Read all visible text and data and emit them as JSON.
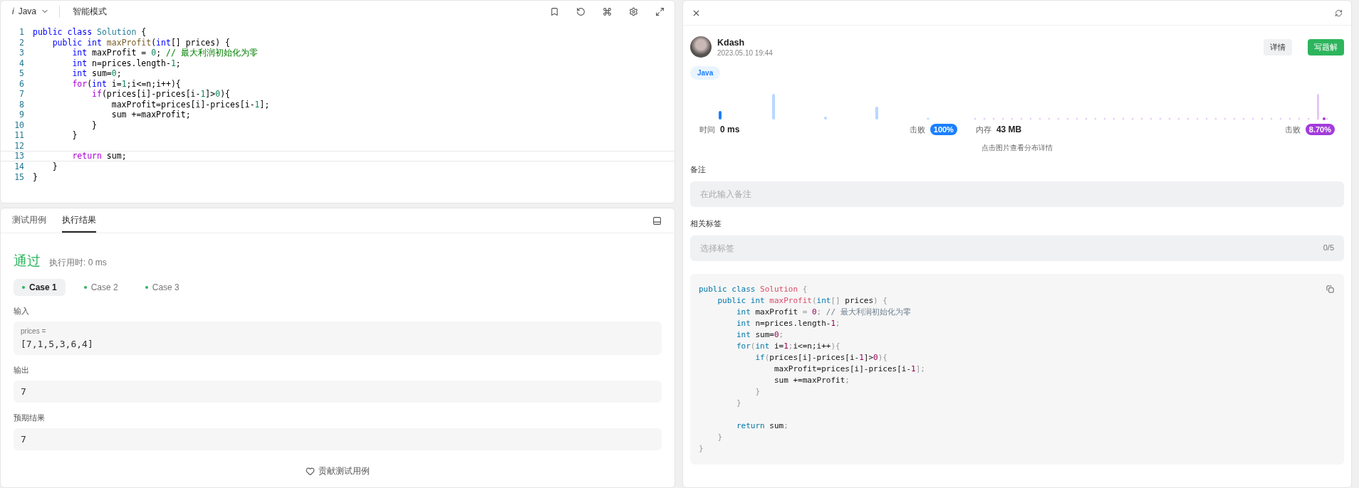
{
  "editor": {
    "language_icon": "i",
    "language": "Java",
    "mode": "智能模式",
    "lines": [
      {
        "number": "1",
        "tokens": [
          {
            "kind": "kw",
            "text": "public class "
          },
          {
            "kind": "type",
            "text": "Solution"
          },
          {
            "kind": "plain",
            "text": " {"
          }
        ]
      },
      {
        "number": "2",
        "tokens": [
          {
            "kind": "kw",
            "text": "    public int "
          },
          {
            "kind": "fn",
            "text": "maxProfit"
          },
          {
            "kind": "plain",
            "text": "("
          },
          {
            "kind": "kw",
            "text": "int"
          },
          {
            "kind": "plain",
            "text": "[] prices) {"
          }
        ]
      },
      {
        "number": "3",
        "tokens": [
          {
            "kind": "kw",
            "text": "        int"
          },
          {
            "kind": "plain",
            "text": " maxProfit = "
          },
          {
            "kind": "num",
            "text": "0"
          },
          {
            "kind": "plain",
            "text": "; "
          },
          {
            "kind": "cm",
            "text": "// 最大利润初始化为零"
          }
        ]
      },
      {
        "number": "4",
        "tokens": [
          {
            "kind": "kw",
            "text": "        int"
          },
          {
            "kind": "plain",
            "text": " n=prices.length-"
          },
          {
            "kind": "num",
            "text": "1"
          },
          {
            "kind": "plain",
            "text": ";"
          }
        ]
      },
      {
        "number": "5",
        "tokens": [
          {
            "kind": "kw",
            "text": "        int"
          },
          {
            "kind": "plain",
            "text": " sum="
          },
          {
            "kind": "num",
            "text": "0"
          },
          {
            "kind": "plain",
            "text": ";"
          }
        ]
      },
      {
        "number": "6",
        "tokens": [
          {
            "kind": "ctl",
            "text": "        for"
          },
          {
            "kind": "plain",
            "text": "("
          },
          {
            "kind": "kw",
            "text": "int"
          },
          {
            "kind": "plain",
            "text": " i="
          },
          {
            "kind": "num",
            "text": "1"
          },
          {
            "kind": "plain",
            "text": ";i<=n;i++){"
          }
        ]
      },
      {
        "number": "7",
        "tokens": [
          {
            "kind": "ctl",
            "text": "            if"
          },
          {
            "kind": "plain",
            "text": "(prices[i]-prices[i-"
          },
          {
            "kind": "num",
            "text": "1"
          },
          {
            "kind": "plain",
            "text": "]>"
          },
          {
            "kind": "num",
            "text": "0"
          },
          {
            "kind": "plain",
            "text": "){"
          }
        ]
      },
      {
        "number": "8",
        "tokens": [
          {
            "kind": "plain",
            "text": "                maxProfit=prices[i]-prices[i-"
          },
          {
            "kind": "num",
            "text": "1"
          },
          {
            "kind": "plain",
            "text": "];"
          }
        ]
      },
      {
        "number": "9",
        "tokens": [
          {
            "kind": "plain",
            "text": "                sum +=maxProfit;"
          }
        ]
      },
      {
        "number": "10",
        "tokens": [
          {
            "kind": "plain",
            "text": "            }"
          }
        ]
      },
      {
        "number": "11",
        "tokens": [
          {
            "kind": "plain",
            "text": "        }"
          }
        ]
      },
      {
        "number": "12"
      },
      {
        "number": "13",
        "tokens": [
          {
            "kind": "ctl",
            "text": "        return"
          },
          {
            "kind": "plain",
            "text": " sum;"
          }
        ]
      },
      {
        "number": "14",
        "tokens": [
          {
            "kind": "plain",
            "text": "    }"
          }
        ]
      },
      {
        "number": "15",
        "tokens": [
          {
            "kind": "plain",
            "text": "}"
          }
        ]
      }
    ]
  },
  "console": {
    "tabs": [
      {
        "label": "测试用例",
        "selected": false
      },
      {
        "label": "执行结果",
        "selected": true
      }
    ],
    "status": "通过",
    "runtime": "执行用时: 0 ms",
    "cases": [
      {
        "label": "Case 1",
        "selected": true
      },
      {
        "label": "Case 2",
        "selected": false
      },
      {
        "label": "Case 3",
        "selected": false
      }
    ],
    "input_label": "输入",
    "input_name": "prices =",
    "input_value": "[7,1,5,3,6,4]",
    "output_label": "输出",
    "output_value": "7",
    "expected_label": "预期结果",
    "expected_value": "7",
    "contribute": "贡献测试用例"
  },
  "submission": {
    "user": "Kdash",
    "time": "2023.05.10 19:44",
    "buttons": [
      {
        "label": "详情",
        "kind": "secondary"
      },
      {
        "label": "写题解",
        "kind": "primary"
      }
    ],
    "language_tag": "Java",
    "runtime_label": "时间",
    "runtime_value": "0 ms",
    "runtime_beat_label": "击败",
    "runtime_beat": "100%",
    "memory_label": "内存",
    "memory_value": "43 MB",
    "memory_beat_label": "击败",
    "memory_beat": "8.70%",
    "chart_hint": "点击图片查看分布详情",
    "note_label": "备注",
    "note_placeholder": "在此输入备注",
    "tags_label": "相关标签",
    "tags_placeholder": "选择标签",
    "tags_count": "0/5",
    "code_blocks": [
      {
        "lines": [
          [
            {
              "kind": "kw",
              "text": "public class "
            },
            {
              "kind": "type",
              "text": "Solution"
            },
            {
              "kind": "punc",
              "text": " {"
            }
          ],
          [
            {
              "kind": "kw",
              "text": "    public int "
            },
            {
              "kind": "type",
              "text": "maxProfit"
            },
            {
              "kind": "punc",
              "text": "("
            },
            {
              "kind": "kw",
              "text": "int"
            },
            {
              "kind": "punc",
              "text": "[] "
            },
            {
              "kind": "plain",
              "text": "prices"
            },
            {
              "kind": "punc",
              "text": ") {"
            }
          ],
          [
            {
              "kind": "kw",
              "text": "        int"
            },
            {
              "kind": "plain",
              "text": " maxProfit "
            },
            {
              "kind": "punc",
              "text": "= "
            },
            {
              "kind": "num",
              "text": "0"
            },
            {
              "kind": "punc",
              "text": "; "
            },
            {
              "kind": "cm",
              "text": "// 最大利润初始化为零"
            }
          ],
          [
            {
              "kind": "kw",
              "text": "        int"
            },
            {
              "kind": "plain",
              "text": " n=prices.length-"
            },
            {
              "kind": "num",
              "text": "1"
            },
            {
              "kind": "punc",
              "text": ";"
            }
          ],
          [
            {
              "kind": "kw",
              "text": "        int"
            },
            {
              "kind": "plain",
              "text": " sum="
            },
            {
              "kind": "num",
              "text": "0"
            },
            {
              "kind": "punc",
              "text": ";"
            }
          ],
          [
            {
              "kind": "kw",
              "text": "        for"
            },
            {
              "kind": "punc",
              "text": "("
            },
            {
              "kind": "kw",
              "text": "int"
            },
            {
              "kind": "plain",
              "text": " i="
            },
            {
              "kind": "num",
              "text": "1"
            },
            {
              "kind": "punc",
              "text": ";"
            },
            {
              "kind": "plain",
              "text": "i<=n;i++"
            },
            {
              "kind": "punc",
              "text": "){"
            }
          ],
          [
            {
              "kind": "kw",
              "text": "            if"
            },
            {
              "kind": "punc",
              "text": "("
            },
            {
              "kind": "plain",
              "text": "prices[i]-prices[i-"
            },
            {
              "kind": "num",
              "text": "1"
            },
            {
              "kind": "plain",
              "text": "]>"
            },
            {
              "kind": "num",
              "text": "0"
            },
            {
              "kind": "punc",
              "text": "){"
            }
          ],
          [
            {
              "kind": "plain",
              "text": "                maxProfit=prices[i]-prices[i-"
            },
            {
              "kind": "num",
              "text": "1"
            },
            {
              "kind": "punc",
              "text": "];"
            }
          ],
          [
            {
              "kind": "plain",
              "text": "                sum +=maxProfit"
            },
            {
              "kind": "punc",
              "text": ";"
            }
          ],
          [
            {
              "kind": "punc",
              "text": "            }"
            }
          ],
          [
            {
              "kind": "punc",
              "text": "        }"
            }
          ]
        ]
      },
      {
        "lines": [
          [
            {
              "kind": "kw",
              "text": "        return"
            },
            {
              "kind": "plain",
              "text": " sum"
            },
            {
              "kind": "punc",
              "text": ";"
            }
          ],
          [
            {
              "kind": "punc",
              "text": "    }"
            }
          ],
          [
            {
              "kind": "punc",
              "text": "}"
            }
          ]
        ]
      }
    ]
  }
}
